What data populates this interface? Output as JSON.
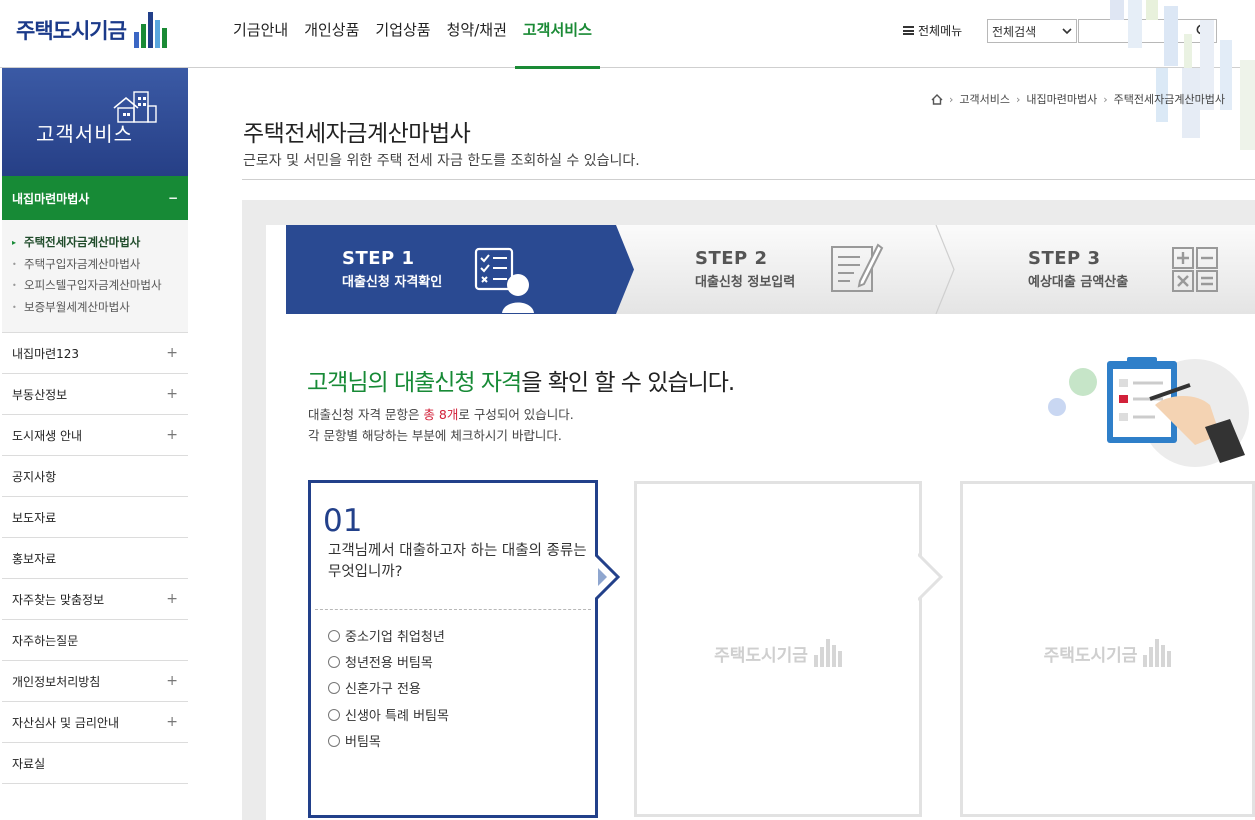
{
  "header": {
    "logo_text": "주택도시기금",
    "nav": [
      "기금안내",
      "개인상품",
      "기업상품",
      "청약/채권",
      "고객서비스"
    ],
    "active_nav_index": 4,
    "all_menu": "전체메뉴",
    "search_select": "전체검색",
    "search_placeholder": "",
    "accent": "#1a8a35"
  },
  "sidebar": {
    "head_title": "고객서비스",
    "active_group": "내집마련마법사",
    "active_group_toggle": "−",
    "sub_items": [
      "주택전세자금계산마법사",
      "주택구입자금계산마법사",
      "오피스텔구입자금계산마법사",
      "보증부월세계산마법사"
    ],
    "current_sub_index": 0,
    "items": [
      {
        "label": "내집마련123",
        "toggle": "+"
      },
      {
        "label": "부동산정보",
        "toggle": "+"
      },
      {
        "label": "도시재생 안내",
        "toggle": "+"
      },
      {
        "label": "공지사항",
        "toggle": ""
      },
      {
        "label": "보도자료",
        "toggle": ""
      },
      {
        "label": "홍보자료",
        "toggle": ""
      },
      {
        "label": "자주찾는 맞춤정보",
        "toggle": "+"
      },
      {
        "label": "자주하는질문",
        "toggle": ""
      },
      {
        "label": "개인정보처리방침",
        "toggle": "+"
      },
      {
        "label": "자산심사 및 금리안내",
        "toggle": "+"
      },
      {
        "label": "자료실",
        "toggle": ""
      }
    ],
    "head_color": "#2f4d97",
    "active_color": "#178a36"
  },
  "breadcrumb": [
    "고객서비스",
    "내집마련마법사",
    "주택전세자금계산마법사"
  ],
  "page": {
    "title": "주택전세자금계산마법사",
    "desc": "근로자 및 서민을 위한 주택 전세 자금 한도를 조회하실 수 있습니다."
  },
  "steps": [
    {
      "label": "STEP 1",
      "sub": "대출신청 자격확인"
    },
    {
      "label": "STEP 2",
      "sub": "대출신청 정보입력"
    },
    {
      "label": "STEP 3",
      "sub": "예상대출 금액산출"
    }
  ],
  "intro": {
    "title_green": "고객님의 대출신청 자격",
    "title_rest": "을 확인 할 수 있습니다.",
    "desc1_pre": "대출신청 자격 문항은 ",
    "desc1_red": "총 8개",
    "desc1_post": "로 구성되어 있습니다.",
    "desc2": "각 문항별 해당하는 부분에 체크하시기 바랍니다."
  },
  "question": {
    "number": "01",
    "text": "고객님께서 대출하고자 하는 대출의 종류는 무엇입니까?",
    "options": [
      "중소기업 취업청년",
      "청년전용 버팀목",
      "신혼가구 전용",
      "신생아 특례 버팀목",
      "버팀목"
    ]
  },
  "placeholder_logo": "주택도시기금"
}
